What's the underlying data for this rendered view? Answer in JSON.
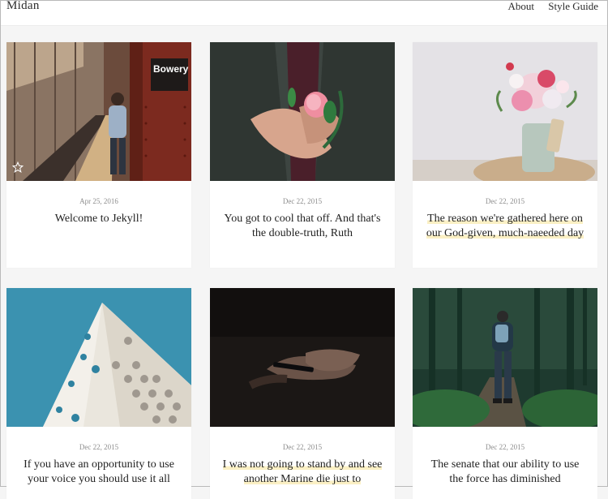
{
  "header": {
    "brand": "Midan",
    "nav": [
      "About",
      "Style Guide"
    ]
  },
  "posts": [
    {
      "date": "Apr 25, 2016",
      "title": "Welcome to Jekyll!",
      "image": "subway-platform-photo",
      "starred": true,
      "highlighted": false
    },
    {
      "date": "Dec 22, 2015",
      "title": "You got to cool that off. And that's the double-truth, Ruth",
      "image": "hands-holding-rose-photo",
      "highlighted": false
    },
    {
      "date": "Dec 22, 2015",
      "title": "The reason we're gathered here on our God-given, much-naeeded day",
      "image": "flower-vase-photo",
      "highlighted": true
    },
    {
      "date": "Dec 22, 2015",
      "title": "If you have an opportunity to use your voice you should use it all",
      "image": "white-building-photo",
      "highlighted": false
    },
    {
      "date": "Dec 22, 2015",
      "title": "I was not going to stand by and see another Marine die just to",
      "image": "hands-phone-dark-photo",
      "highlighted": true
    },
    {
      "date": "Dec 22, 2015",
      "title": "The senate that our ability to use the force has diminished",
      "image": "forest-hiker-photo",
      "highlighted": false
    }
  ],
  "subway_sign": "Bowery",
  "colors": {
    "accent_highlight": "#fbf0c4",
    "background": "#f5f5f5",
    "card": "#ffffff"
  }
}
